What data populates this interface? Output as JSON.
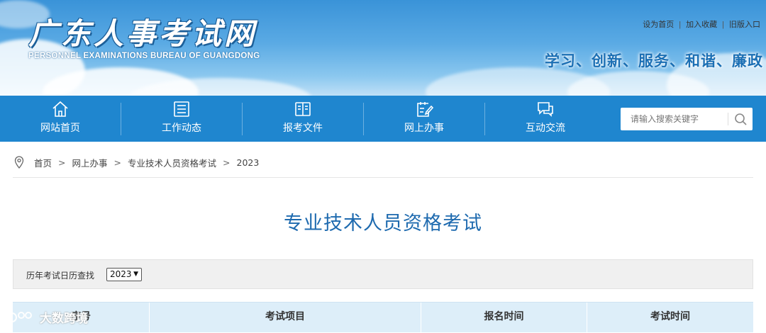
{
  "header": {
    "title": "广东人事考试网",
    "subtitle": "PERSONNEL EXAMINATIONS BUREAU OF GUANGDONG",
    "links": [
      "设为首页",
      "加入收藏",
      "旧版入口"
    ],
    "slogan": "学习、创新、服务、和谐、廉政"
  },
  "nav": {
    "items": [
      {
        "label": "网站首页",
        "icon": "home-icon"
      },
      {
        "label": "工作动态",
        "icon": "news-icon"
      },
      {
        "label": "报考文件",
        "icon": "book-icon"
      },
      {
        "label": "网上办事",
        "icon": "edit-icon"
      },
      {
        "label": "互动交流",
        "icon": "chat-icon"
      }
    ],
    "search_placeholder": "请输入搜索关键字"
  },
  "breadcrumb": {
    "items": [
      "首页",
      "网上办事",
      "专业技术人员资格考试",
      "2023"
    ],
    "separator": ">"
  },
  "page": {
    "title": "专业技术人员资格考试"
  },
  "filter": {
    "label": "历年考试日历查找",
    "selected_year": "2023"
  },
  "table": {
    "columns": [
      "序号",
      "考试项目",
      "报名时间",
      "考试时间"
    ]
  },
  "watermark": {
    "text": "大数跨境"
  },
  "colors": {
    "nav_bg": "#1f86cf",
    "title": "#1e6aaf",
    "table_header_bg": "#ddeef9"
  }
}
